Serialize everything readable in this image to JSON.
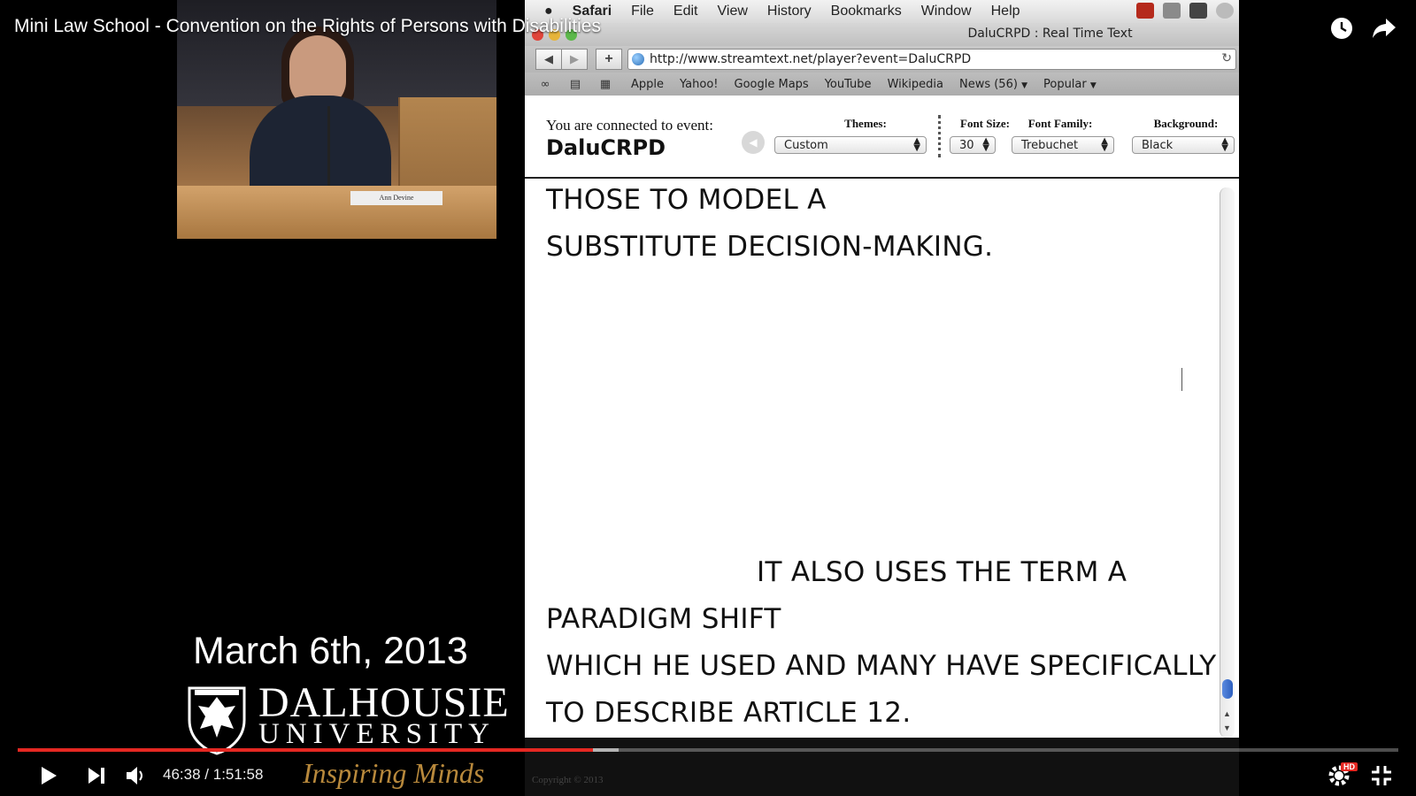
{
  "video": {
    "title": "Mini Law School - Convention on the Rights of Persons with Disabilities",
    "current_time": "46:38",
    "separator": "/",
    "duration": "1:51:58",
    "progress_fraction": 0.4165,
    "buffered_fraction": 0.435,
    "quality_badge": "HD",
    "accent_color": "#e52822"
  },
  "speaker_inset": {
    "nameplate": "Ann Devine"
  },
  "mac_menubar": {
    "items": [
      "Safari",
      "File",
      "Edit",
      "View",
      "History",
      "Bookmarks",
      "Window",
      "Help"
    ]
  },
  "safari": {
    "window_title": "DaluCRPD : Real Time Text",
    "url": "http://www.streamtext.net/player?event=DaluCRPD",
    "bookmarks": [
      "Apple",
      "Yahoo!",
      "Google Maps",
      "YouTube",
      "Wikipedia",
      "News (56)",
      "Popular"
    ]
  },
  "streamtext": {
    "connected_label": "You are connected to event:",
    "event_name": "DaluCRPD",
    "themes_label": "Themes:",
    "themes_value": "Custom",
    "font_size_label": "Font Size:",
    "font_size_value": "30",
    "font_family_label": "Font Family:",
    "font_family_value": "Trebuchet",
    "background_label": "Background:",
    "background_value": "Black",
    "transcript_lines": [
      "THOSE TO MODEL A",
      "SUBSTITUTE DECISION-MAKING.",
      "IT ALSO USES THE TERM A",
      "PARADIGM SHIFT",
      "WHICH HE USED AND MANY HAVE SPECIFICALLY",
      "TO DESCRIBE ARTICLE 12."
    ],
    "copyright": "Copyright © 2013"
  },
  "branding": {
    "date": "March 6th, 2013",
    "university_line1": "DALHOUSIE",
    "university_line2": "UNIVERSITY",
    "tagline": "Inspiring Minds"
  }
}
